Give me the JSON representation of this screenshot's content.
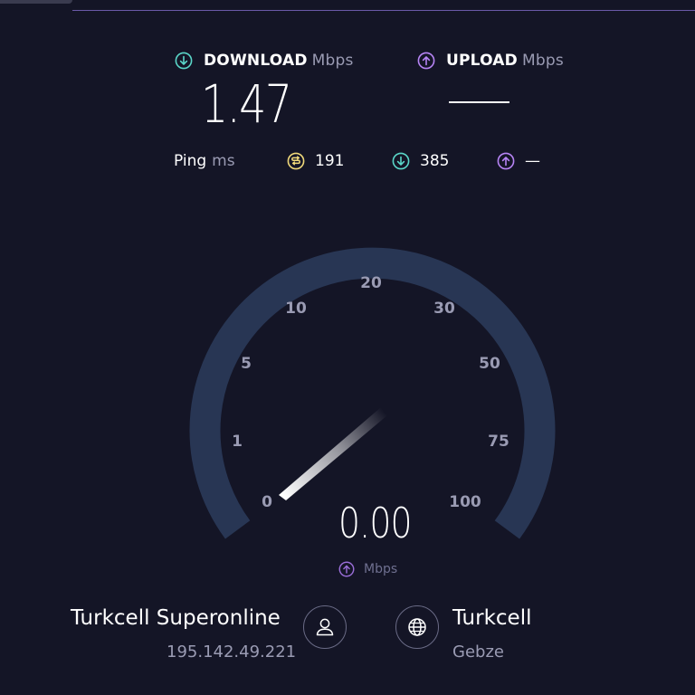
{
  "results": {
    "download": {
      "label": "DOWNLOAD",
      "unit": "Mbps",
      "value": "1.47",
      "icon": "download-arrow-icon",
      "color": "#5ad6c8"
    },
    "upload": {
      "label": "UPLOAD",
      "unit": "Mbps",
      "value": "—",
      "icon": "upload-arrow-icon",
      "color": "#b784f5"
    }
  },
  "ping": {
    "label": "Ping",
    "unit": "ms",
    "idle": {
      "value": "191",
      "icon": "idle-latency-icon",
      "color": "#f0d97a"
    },
    "download": {
      "value": "385",
      "icon": "download-arrow-icon",
      "color": "#5ad6c8"
    },
    "upload": {
      "value": "—",
      "icon": "upload-arrow-icon",
      "color": "#b784f5"
    }
  },
  "gauge": {
    "scale_labels": [
      "0",
      "1",
      "5",
      "10",
      "20",
      "30",
      "50",
      "75",
      "100"
    ],
    "current_value": "0.00",
    "unit": "Mbps",
    "unit_icon": "upload-arrow-icon",
    "needle_speed_fraction": 0.0,
    "track_color": "#283654",
    "needle_color": "#ffffff"
  },
  "client": {
    "isp": "Turkcell Superonline",
    "ip": "195.142.49.221",
    "icon": "user-icon"
  },
  "server": {
    "name": "Turkcell",
    "city": "Gebze",
    "icon": "globe-icon"
  }
}
